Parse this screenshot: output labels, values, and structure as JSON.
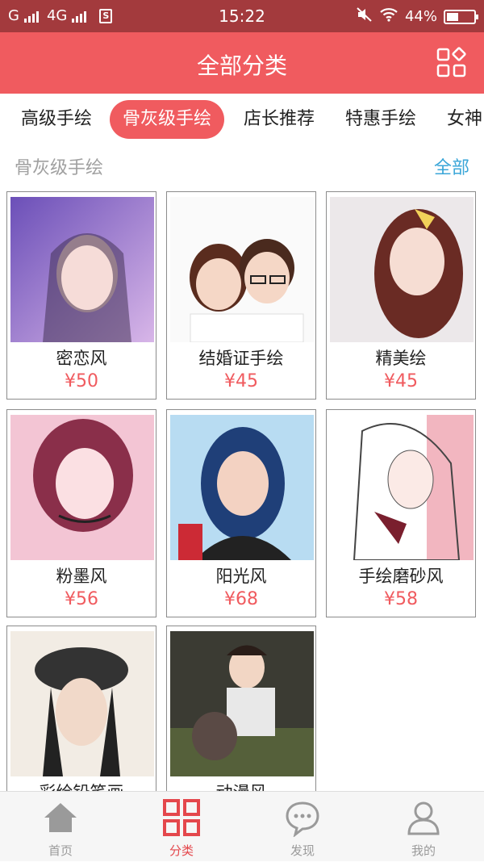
{
  "status_bar": {
    "carrier1": "G",
    "carrier2": "4G",
    "time": "15:22",
    "battery": "44%",
    "battery_level": 0.44
  },
  "header": {
    "title": "全部分类",
    "menu_icon": "grid-icon"
  },
  "tabs": [
    {
      "label": "高级手绘",
      "active": false
    },
    {
      "label": "骨灰级手绘",
      "active": true
    },
    {
      "label": "店长推荐",
      "active": false
    },
    {
      "label": "特惠手绘",
      "active": false
    },
    {
      "label": "女神",
      "active": false
    }
  ],
  "section": {
    "name": "骨灰级手绘",
    "all_link": "全部"
  },
  "products": [
    {
      "name": "密恋风",
      "price": "¥50"
    },
    {
      "name": "结婚证手绘",
      "price": "¥45"
    },
    {
      "name": "精美绘",
      "price": "¥45"
    },
    {
      "name": "粉墨风",
      "price": "¥56"
    },
    {
      "name": "阳光风",
      "price": "¥68"
    },
    {
      "name": "手绘磨砂风",
      "price": "¥58"
    },
    {
      "name": "彩绘铅笔画",
      "price": ""
    },
    {
      "name": "动漫风",
      "price": ""
    }
  ],
  "bottom_nav": [
    {
      "label": "首页",
      "icon": "home-icon",
      "active": false
    },
    {
      "label": "分类",
      "icon": "category-grid-icon",
      "active": true
    },
    {
      "label": "发现",
      "icon": "chat-bubble-icon",
      "active": false
    },
    {
      "label": "我的",
      "icon": "user-icon",
      "active": false
    }
  ],
  "colors": {
    "accent": "#f05b5f",
    "status_bar": "#a33a3d",
    "link": "#3aa6d8",
    "muted": "#a0a0a0"
  }
}
